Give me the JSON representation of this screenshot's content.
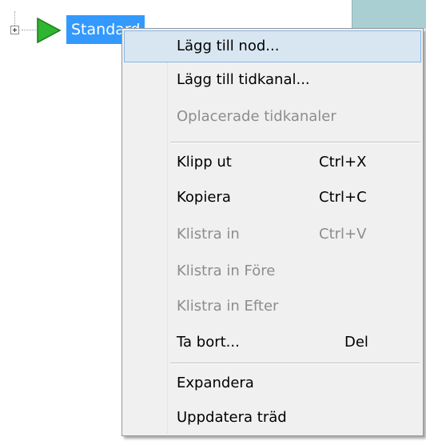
{
  "tree": {
    "node_label": "Standard"
  },
  "context_menu": {
    "items": [
      {
        "label": "Lägg till nod...",
        "shortcut": "",
        "enabled": true,
        "highlighted": true
      },
      {
        "label": "Lägg till tidkanal...",
        "shortcut": "",
        "enabled": true
      },
      {
        "label": "Oplacerade tidkanaler",
        "shortcut": "",
        "enabled": false
      },
      {
        "label": "Klipp ut",
        "shortcut": "Ctrl+X",
        "enabled": true
      },
      {
        "label": "Kopiera",
        "shortcut": "Ctrl+C",
        "enabled": true
      },
      {
        "label": "Klistra in",
        "shortcut": "Ctrl+V",
        "enabled": false
      },
      {
        "label": "Klistra in Före",
        "shortcut": "",
        "enabled": false
      },
      {
        "label": "Klistra in Efter",
        "shortcut": "",
        "enabled": false
      },
      {
        "label": "Ta bort...",
        "shortcut": "Del",
        "enabled": true
      },
      {
        "label": "Expandera",
        "shortcut": "",
        "enabled": true
      },
      {
        "label": "Uppdatera träd",
        "shortcut": "",
        "enabled": true
      }
    ]
  },
  "icons": {
    "expander": "expand-plus-icon",
    "node": "play-triangle-icon"
  },
  "colors": {
    "selection": "#3399ff",
    "menu_bg": "#f0f0f0",
    "menu_highlight": "#d8e6f2",
    "play_icon": "#2fb52f",
    "disabled_text": "#8d8d8d"
  }
}
